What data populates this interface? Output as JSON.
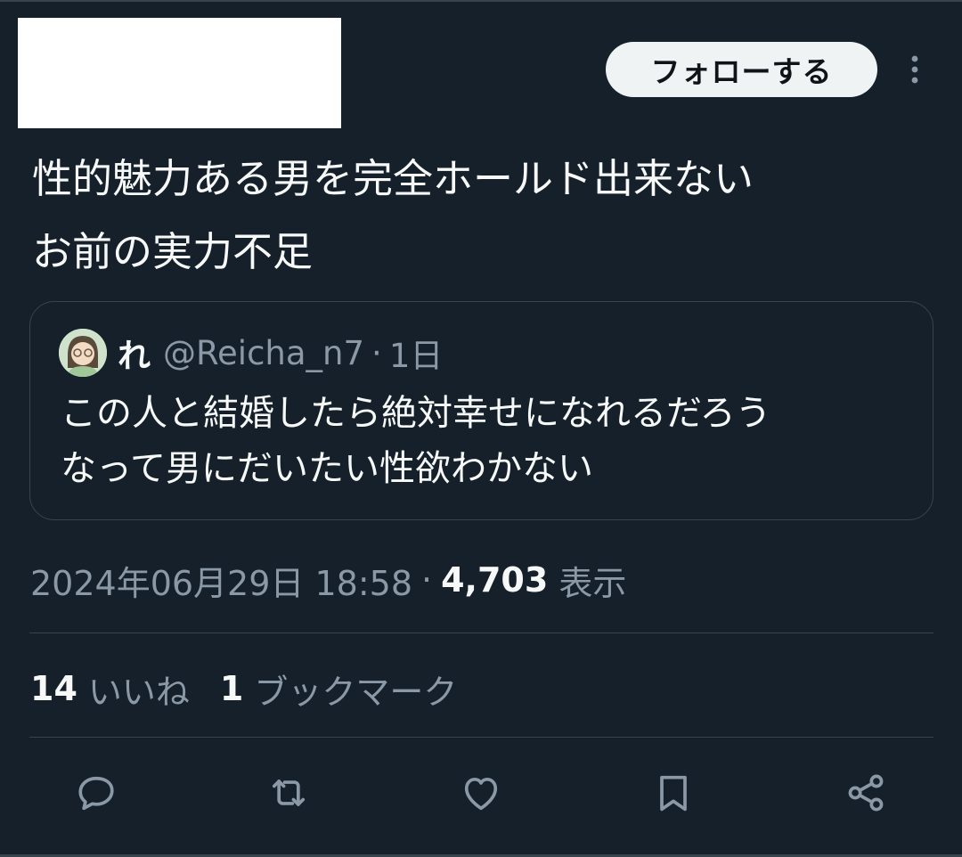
{
  "header": {
    "follow_label": "フォローする",
    "more_icon": "more-vertical-icon"
  },
  "tweet": {
    "text": "性的魅力ある男を完全ホールド出来ない\nお前の実力不足"
  },
  "quote": {
    "name": "れ",
    "handle": "@Reicha_n7",
    "separator": "·",
    "time": "1日",
    "text": "この人と結婚したら絶対幸せになれるだろう\nなって男にだいたい性欲わかない"
  },
  "meta": {
    "date": "2024年06月29日 18:58",
    "separator": "·",
    "views": "4,703",
    "views_label": "表示"
  },
  "stats": {
    "likes_count": "14",
    "likes_label": "いいね",
    "bookmarks_count": "1",
    "bookmarks_label": "ブックマーク"
  },
  "actions": [
    "reply-icon",
    "retweet-icon",
    "like-icon",
    "bookmark-icon",
    "share-icon"
  ],
  "colors": {
    "background": "#15202b",
    "border": "#38444d",
    "text": "#f7f9f9",
    "secondary": "#8b98a5",
    "button_bg": "#eff3f4"
  }
}
